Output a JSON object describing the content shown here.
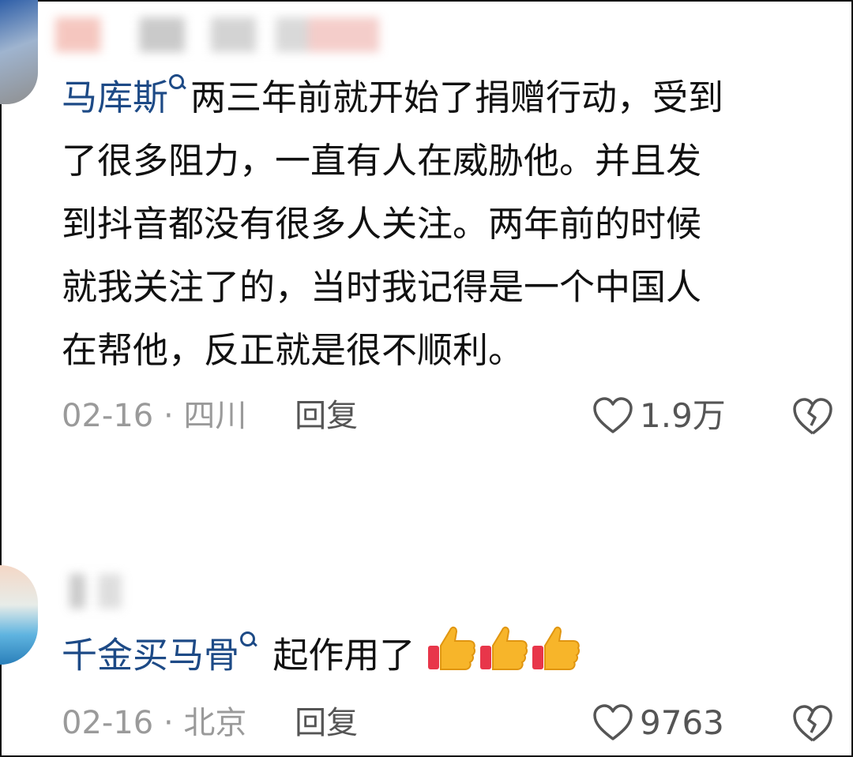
{
  "comments": [
    {
      "username": "马库斯",
      "lines": [
        "两三年前就开始了捐赠行动，受到",
        "了很多阻力，一直有人在威胁他。并且发",
        "到抖音都没有很多人关注。两年前的时候",
        "就我关注了的，当时我记得是一个中国人",
        "在帮他，反正就是很不顺利。"
      ],
      "date": "02-16",
      "separator": "·",
      "location": "四川",
      "reply_label": "回复",
      "likes": "1.9万"
    },
    {
      "username": "千金买马骨",
      "text": "起作用了",
      "emoji": [
        "thumbs-up-icon",
        "thumbs-up-icon",
        "thumbs-up-icon"
      ],
      "date": "02-16",
      "separator": "·",
      "location": "北京",
      "reply_label": "回复",
      "likes": "9763"
    }
  ],
  "colors": {
    "username": "#1d4a86",
    "meta": "#9a9a9a",
    "text": "#111111"
  }
}
